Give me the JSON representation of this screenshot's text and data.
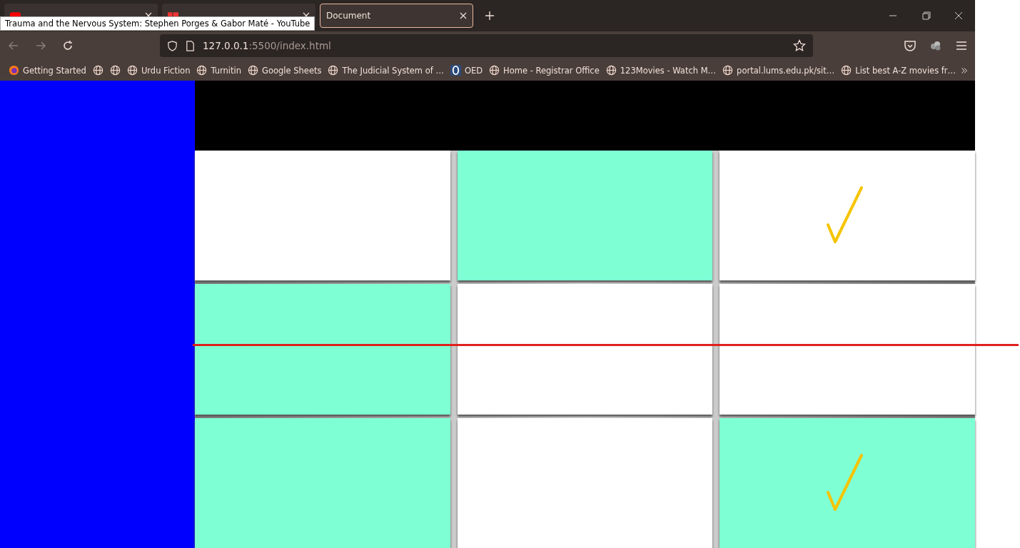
{
  "browser": {
    "tabs": [
      {
        "selected": false
      },
      {
        "selected": false
      },
      {
        "title": "Document",
        "selected": true
      }
    ],
    "tooltip": "Trauma and the Nervous System: Stephen Porges & Gabor Maté - YouTube",
    "url_host": "127.0.0.1",
    "url_path": ":5500/index.html",
    "bookmarks": [
      "Getting Started",
      "Urdu Fiction",
      "Turnitin",
      "Google Sheets",
      "The Judicial System of …",
      "OED",
      "Home - Registrar Office",
      "123Movies - Watch M…",
      "portal.lums.edu.pk/sit…",
      "List best A-Z movies fr…"
    ]
  },
  "grid": {
    "cells": [
      {
        "filled": false,
        "checked": false
      },
      {
        "filled": true,
        "checked": false
      },
      {
        "filled": false,
        "checked": true
      },
      {
        "filled": true,
        "checked": false
      },
      {
        "filled": false,
        "checked": false
      },
      {
        "filled": false,
        "checked": false
      },
      {
        "filled": true,
        "checked": false
      },
      {
        "filled": false,
        "checked": false
      },
      {
        "filled": true,
        "checked": true
      }
    ]
  }
}
